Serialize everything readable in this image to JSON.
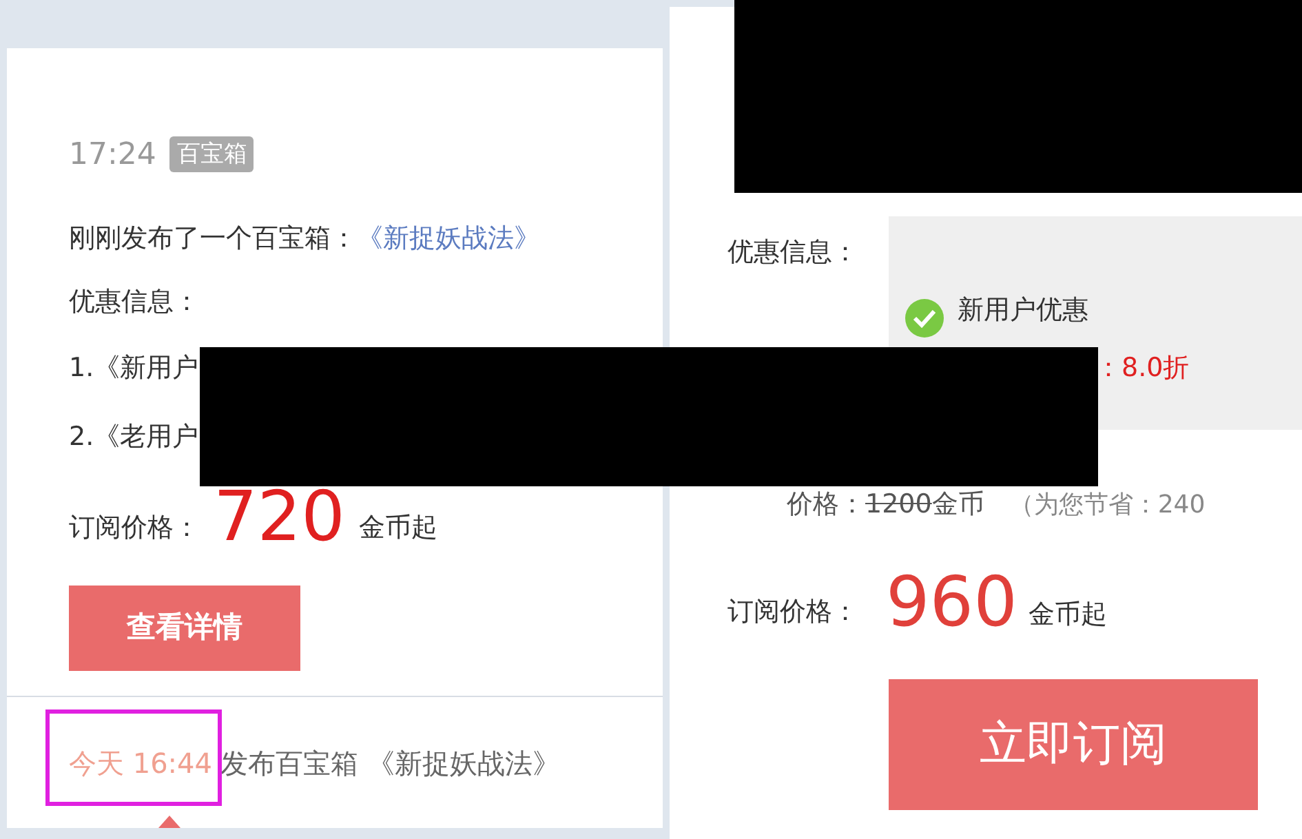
{
  "left_card": {
    "time": "17:24",
    "tag": "百宝箱",
    "announcement": {
      "text": "刚刚发布了一个百宝箱：",
      "link": "《新捉妖战法》"
    },
    "offers_label": "优惠信息：",
    "offers": [
      "1.《新用户",
      "2.《老用户"
    ],
    "price_label": "订阅价格：",
    "price": "720",
    "price_unit": "金币起",
    "button": "查看详情"
  },
  "feed_item": {
    "time": "今天 16:44",
    "text": "发布百宝箱 《新捉妖战法》"
  },
  "right_card": {
    "offers_label": "优惠信息：",
    "offer": {
      "title": "新用户优惠",
      "checked": true,
      "discount": "：8.0折"
    },
    "original_price_label": "价格：",
    "original_price": "1200",
    "original_unit": "金币",
    "savings": "（为您节省：240",
    "price_label": "订阅价格：",
    "price": "960",
    "price_unit": "金币起",
    "button": "立即订阅"
  }
}
